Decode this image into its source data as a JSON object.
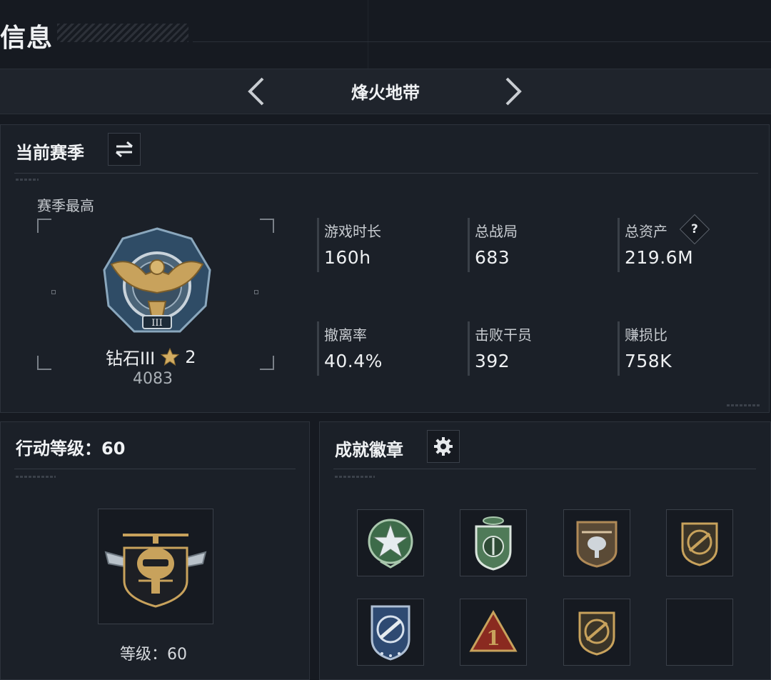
{
  "page": {
    "title": "信息"
  },
  "mode": {
    "title": "烽火地带",
    "prev_icon": "chevron-left-icon",
    "next_icon": "chevron-right-icon"
  },
  "season": {
    "header": "当前赛季",
    "switch_icon": "swap-arrows-icon",
    "best_label": "赛季最高",
    "rank_name": "钻石III",
    "rank_star_icon": "star-icon",
    "rank_stars": "2",
    "rank_score": "4083",
    "stats": [
      {
        "label": "游戏时长",
        "value": "160h"
      },
      {
        "label": "总战局",
        "value": "683"
      },
      {
        "label": "总资产",
        "value": "219.6M"
      },
      {
        "label": "撤离率",
        "value": "40.4%"
      },
      {
        "label": "击败干员",
        "value": "392"
      },
      {
        "label": "赚损比",
        "value": "758K"
      }
    ],
    "help_label": "?"
  },
  "level": {
    "header": "行动等级：60",
    "label": "等级：60"
  },
  "achievements": {
    "header": "成就徽章",
    "settings_icon": "gear-icon"
  },
  "colors": {
    "background": "#161a21",
    "panel": "#1b2028",
    "gold": "#c8a25c",
    "green_badge": "#4f7a58",
    "steel_blue": "#3e5872"
  }
}
